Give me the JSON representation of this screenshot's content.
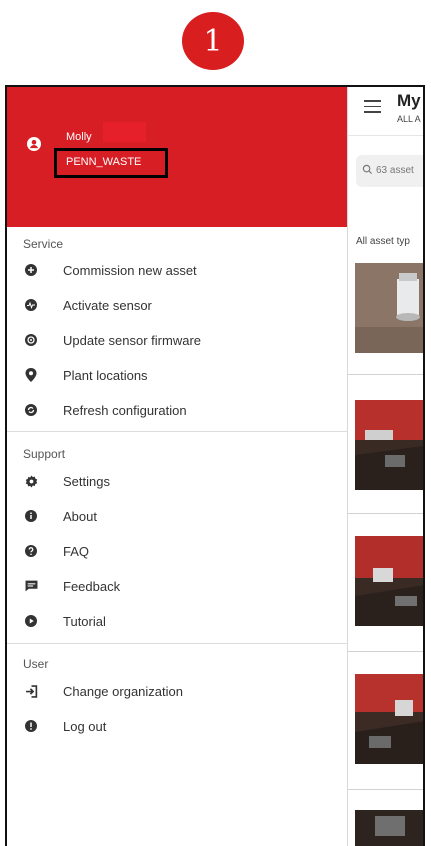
{
  "step_number": "1",
  "header": {
    "user_name": "Molly",
    "organization": "PENN_WASTE"
  },
  "sections": [
    {
      "title": "Service",
      "items": [
        {
          "label": "Commission new asset",
          "icon": "plus-circle-icon"
        },
        {
          "label": "Activate sensor",
          "icon": "pulse-icon"
        },
        {
          "label": "Update sensor firmware",
          "icon": "target-icon"
        },
        {
          "label": "Plant locations",
          "icon": "location-pin-icon"
        },
        {
          "label": "Refresh configuration",
          "icon": "sync-icon"
        }
      ]
    },
    {
      "title": "Support",
      "items": [
        {
          "label": "Settings",
          "icon": "gear-icon"
        },
        {
          "label": "About",
          "icon": "info-icon"
        },
        {
          "label": "FAQ",
          "icon": "question-icon"
        },
        {
          "label": "Feedback",
          "icon": "feedback-icon"
        },
        {
          "label": "Tutorial",
          "icon": "play-icon"
        }
      ]
    },
    {
      "title": "User",
      "items": [
        {
          "label": "Change organization",
          "icon": "switch-org-icon"
        },
        {
          "label": "Log out",
          "icon": "logout-icon"
        }
      ]
    }
  ],
  "main": {
    "title": "My",
    "subtitle": "ALL A",
    "search_text": "63 asset",
    "filter_text": "All asset typ"
  },
  "colors": {
    "brand_red": "#d81e25",
    "badge_red": "#d81e1e"
  }
}
